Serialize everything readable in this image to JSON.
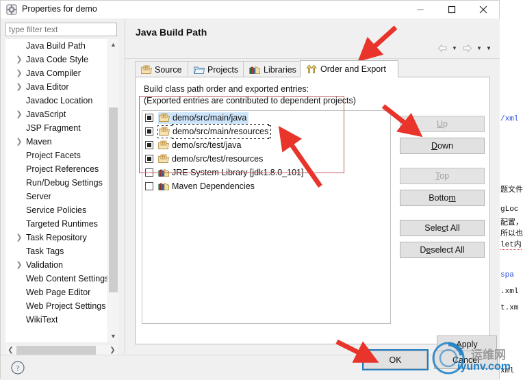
{
  "window": {
    "title": "Properties for demo",
    "icon": "properties-gear-icon",
    "controls": {
      "minimize": "minimize-icon",
      "maximize": "maximize-icon",
      "close": "close-icon"
    }
  },
  "filter": {
    "placeholder": "type filter text",
    "value": ""
  },
  "tree": {
    "selected": "Java Build Path",
    "items": [
      {
        "label": "Java Build Path",
        "expandable": false,
        "selected": true
      },
      {
        "label": "Java Code Style",
        "expandable": true,
        "selected": false
      },
      {
        "label": "Java Compiler",
        "expandable": true,
        "selected": false
      },
      {
        "label": "Java Editor",
        "expandable": true,
        "selected": false
      },
      {
        "label": "Javadoc Location",
        "expandable": false,
        "selected": false
      },
      {
        "label": "JavaScript",
        "expandable": true,
        "selected": false
      },
      {
        "label": "JSP Fragment",
        "expandable": false,
        "selected": false
      },
      {
        "label": "Maven",
        "expandable": true,
        "selected": false
      },
      {
        "label": "Project Facets",
        "expandable": false,
        "selected": false
      },
      {
        "label": "Project References",
        "expandable": false,
        "selected": false
      },
      {
        "label": "Run/Debug Settings",
        "expandable": false,
        "selected": false
      },
      {
        "label": "Server",
        "expandable": false,
        "selected": false
      },
      {
        "label": "Service Policies",
        "expandable": false,
        "selected": false
      },
      {
        "label": "Targeted Runtimes",
        "expandable": false,
        "selected": false
      },
      {
        "label": "Task Repository",
        "expandable": true,
        "selected": false
      },
      {
        "label": "Task Tags",
        "expandable": false,
        "selected": false
      },
      {
        "label": "Validation",
        "expandable": true,
        "selected": false
      },
      {
        "label": "Web Content Settings",
        "expandable": false,
        "selected": false
      },
      {
        "label": "Web Page Editor",
        "expandable": false,
        "selected": false
      },
      {
        "label": "Web Project Settings",
        "expandable": false,
        "selected": false
      },
      {
        "label": "WikiText",
        "expandable": false,
        "selected": false
      }
    ]
  },
  "page": {
    "title": "Java Build Path",
    "tabs": [
      {
        "label": "Source",
        "icon": "source-folder-icon",
        "active": false
      },
      {
        "label": "Projects",
        "icon": "projects-folder-icon",
        "active": false
      },
      {
        "label": "Libraries",
        "icon": "libraries-books-icon",
        "active": false
      },
      {
        "label": "Order and Export",
        "icon": "order-export-arrows-icon",
        "active": true
      }
    ],
    "description_line1": "Build class path order and exported entries:",
    "description_line2": "(Exported entries are contributed to dependent projects)",
    "entries": [
      {
        "label": "demo/src/main/java",
        "checked": true,
        "icon": "source-folder-icon",
        "selected": true,
        "focused": false
      },
      {
        "label": "demo/src/main/resources",
        "checked": true,
        "icon": "source-folder-icon",
        "selected": false,
        "focused": true
      },
      {
        "label": "demo/src/test/java",
        "checked": true,
        "icon": "source-folder-icon",
        "selected": false,
        "focused": false
      },
      {
        "label": "demo/src/test/resources",
        "checked": true,
        "icon": "source-folder-icon",
        "selected": false,
        "focused": false
      },
      {
        "label": "JRE System Library [jdk1.8.0_101]",
        "checked": false,
        "icon": "libraries-books-icon",
        "selected": false,
        "focused": false
      },
      {
        "label": "Maven Dependencies",
        "checked": false,
        "icon": "libraries-books-icon",
        "selected": false,
        "focused": false
      }
    ],
    "side_buttons": [
      {
        "label": "Up",
        "mnemonic": "U",
        "disabled": true
      },
      {
        "label": "Down",
        "mnemonic": "D",
        "disabled": false
      },
      {
        "label": "Top",
        "mnemonic": "T",
        "disabled": true
      },
      {
        "label": "Bottom",
        "mnemonic": "m",
        "disabled": false
      },
      {
        "label": "Select All",
        "mnemonic": "c",
        "disabled": false
      },
      {
        "label": "Deselect All",
        "mnemonic": "e",
        "disabled": false
      }
    ],
    "apply_label": "Apply"
  },
  "navigation": {
    "back": "back-arrow-icon",
    "back_menu": "chevron-down-icon",
    "forward": "forward-arrow-icon",
    "forward_menu": "chevron-down-icon",
    "menu": "view-menu-icon"
  },
  "footer": {
    "help": "help-question-icon",
    "ok_label": "OK",
    "cancel_label": "Cancel"
  },
  "background_editor": {
    "lines": [
      "/xml",
      "题文件",
      "gLoc",
      "配置，",
      "所以也",
      "let内",
      "spa",
      ".xml",
      "t.xm",
      "xml"
    ]
  },
  "watermark": {
    "site": "iyunv.com",
    "cn": "运维网"
  },
  "colors": {
    "accent": "#1f7ec4",
    "annotation": "#e8342a",
    "selection": "#cde5fa",
    "tree_selection": "#d8d8d8",
    "dialog_bg": "#f0f0f0"
  }
}
